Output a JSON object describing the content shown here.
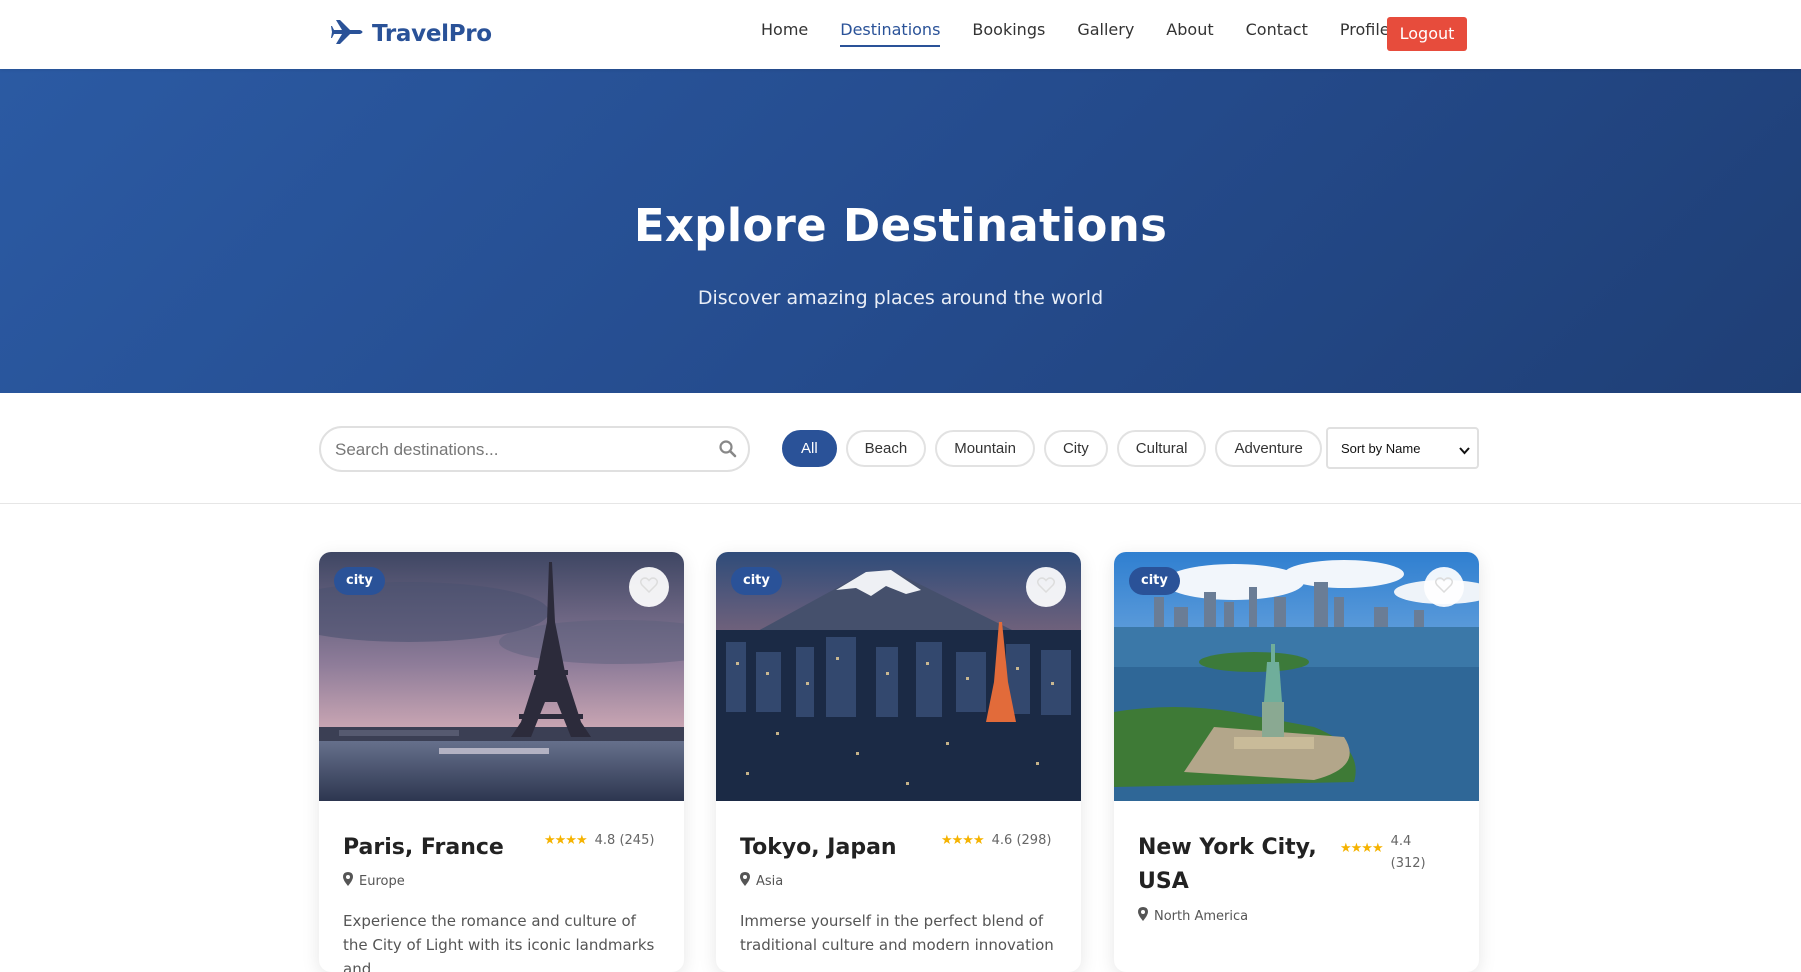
{
  "brand": {
    "name": "TravelPro"
  },
  "nav": {
    "items": [
      {
        "label": "Home",
        "active": false
      },
      {
        "label": "Destinations",
        "active": true
      },
      {
        "label": "Bookings",
        "active": false
      },
      {
        "label": "Gallery",
        "active": false
      },
      {
        "label": "About",
        "active": false
      },
      {
        "label": "Contact",
        "active": false
      },
      {
        "label": "Profile",
        "active": false
      }
    ],
    "logout_label": "Logout"
  },
  "hero": {
    "title": "Explore Destinations",
    "subtitle": "Discover amazing places around the world"
  },
  "filters": {
    "search_placeholder": "Search destinations...",
    "chips": [
      {
        "label": "All",
        "active": true
      },
      {
        "label": "Beach",
        "active": false
      },
      {
        "label": "Mountain",
        "active": false
      },
      {
        "label": "City",
        "active": false
      },
      {
        "label": "Cultural",
        "active": false
      },
      {
        "label": "Adventure",
        "active": false
      }
    ],
    "sort_selected": "Sort by Name"
  },
  "destinations": [
    {
      "tag": "city",
      "name": "Paris, France",
      "stars": "★★★★",
      "rating": "4.8",
      "reviews": "(245)",
      "region": "Europe",
      "description": "Experience the romance and culture of the City of Light with its iconic landmarks and"
    },
    {
      "tag": "city",
      "name": "Tokyo, Japan",
      "stars": "★★★★",
      "rating": "4.6",
      "reviews": "(298)",
      "region": "Asia",
      "description": "Immerse yourself in the perfect blend of traditional culture and modern innovation"
    },
    {
      "tag": "city",
      "name": "New York City, USA",
      "stars": "★★★★",
      "rating": "4.4",
      "reviews": "(312)",
      "region": "North America",
      "description": ""
    }
  ],
  "colors": {
    "brand": "#2a5298",
    "logout": "#e74c3c",
    "star": "#f5b301"
  },
  "icons": {
    "brand": "airplane-icon",
    "search": "search-icon",
    "favorite": "heart-icon",
    "location": "map-pin-icon"
  }
}
